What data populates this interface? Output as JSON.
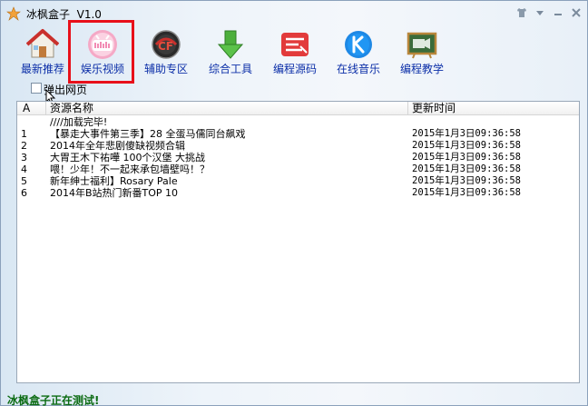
{
  "window": {
    "title": "冰枫盒子  V1.0"
  },
  "toolbar": {
    "items": [
      {
        "label": "最新推荐",
        "icon": "home-icon"
      },
      {
        "label": "娱乐视频",
        "icon": "bilibili-icon"
      },
      {
        "label": "辅助专区",
        "icon": "crossfire-icon"
      },
      {
        "label": "综合工具",
        "icon": "download-arrow-icon"
      },
      {
        "label": "编程源码",
        "icon": "source-code-icon"
      },
      {
        "label": "在线音乐",
        "icon": "kugou-music-icon"
      },
      {
        "label": "编程教学",
        "icon": "video-board-icon"
      }
    ],
    "selected_index": 1
  },
  "popup_option": {
    "label": "弹出网页",
    "checked": false
  },
  "list": {
    "columns": [
      "A",
      "资源名称",
      "更新时间"
    ],
    "rows": [
      {
        "index": "",
        "name": "////加载完毕!",
        "time": ""
      },
      {
        "index": "1",
        "name": "【暴走大事件第三季】28 全蛋马儒同台飙戏",
        "time": "2015年1月3日09:36:58"
      },
      {
        "index": "2",
        "name": "2014年全年悲剧傻缺视频合辑",
        "time": "2015年1月3日09:36:58"
      },
      {
        "index": "3",
        "name": "大胃王木下祐嘩 100个汉堡 大挑战",
        "time": "2015年1月3日09:36:58"
      },
      {
        "index": "4",
        "name": "喂！少年！不一起来承包墙壁吗！？",
        "time": "2015年1月3日09:36:58"
      },
      {
        "index": "5",
        "name": "新年绅士福利】Rosary Pale",
        "time": "2015年1月3日09:36:58"
      },
      {
        "index": "6",
        "name": "2014年B站热门新番TOP 10",
        "time": "2015年1月3日09:36:58"
      }
    ]
  },
  "status": {
    "text": "冰枫盒子正在测试!"
  },
  "colors": {
    "selection_frame": "#e8101a",
    "toolbar_label": "#0c2fa8",
    "status_text": "#0b6b12"
  }
}
